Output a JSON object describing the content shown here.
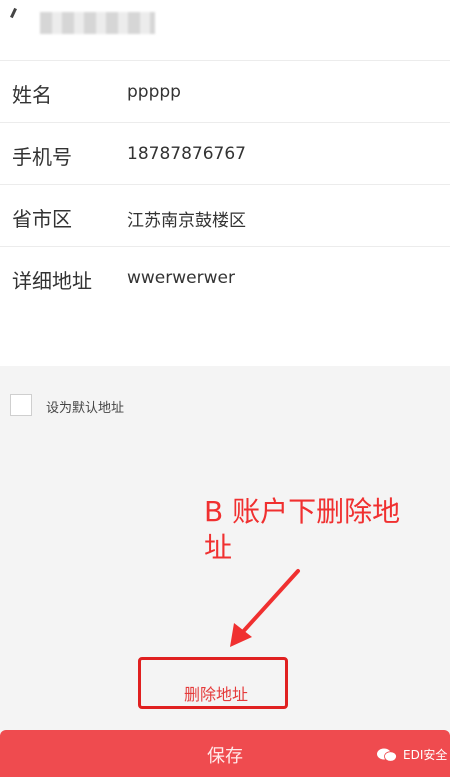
{
  "form": {
    "rows": [
      {
        "label": "姓名",
        "value": "ppppp"
      },
      {
        "label": "手机号",
        "value": "18787876767"
      },
      {
        "label": "省市区",
        "value": "江苏南京鼓楼区"
      },
      {
        "label": "详细地址",
        "value": "wwerwerwer"
      }
    ]
  },
  "options": {
    "default_address_label": "设为默认地址"
  },
  "annotation": {
    "text": "B 账户下删除地址"
  },
  "actions": {
    "delete_label": "删除地址",
    "save_label": "保存"
  },
  "watermark": {
    "text": "EDI安全"
  },
  "colors": {
    "accent": "#ef4b4f",
    "annotation_red": "#f03030"
  }
}
